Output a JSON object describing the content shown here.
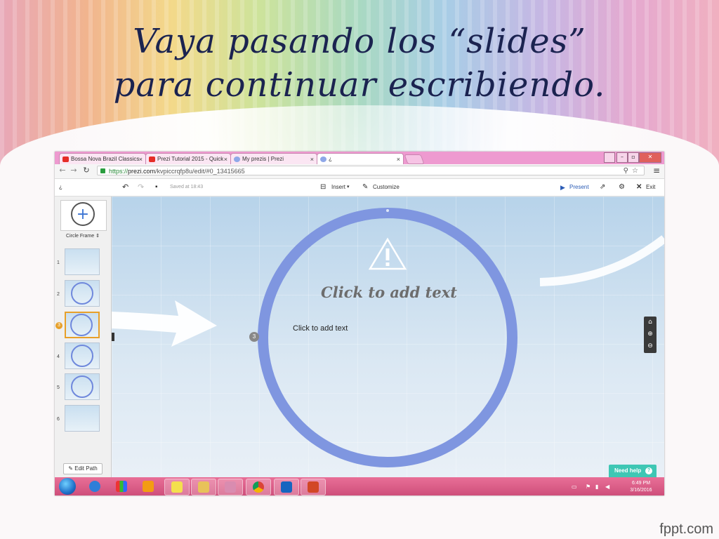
{
  "slide": {
    "title_line1": "Vaya pasando los “slides”",
    "title_line2": "para continuar escribiendo.",
    "watermark": "fppt.com"
  },
  "browser": {
    "tabs": [
      {
        "label": "Bossa Nova Brazil Classics",
        "icon": "youtube-icon",
        "color": "#e52d27"
      },
      {
        "label": "Prezi Tutorial 2015 - Quick",
        "icon": "youtube-icon",
        "color": "#e52d27"
      },
      {
        "label": "My prezis | Prezi",
        "icon": "prezi-icon",
        "color": "#3b74d3"
      },
      {
        "label": "¿",
        "icon": "prezi-icon",
        "color": "#3b74d3"
      }
    ],
    "tab_close": "×",
    "url_protocol": "https://",
    "url_host": "prezi.com",
    "url_path": "/kvpiccrqfp8u/edit/#0_13415665"
  },
  "prezi_toolbar": {
    "doc_title": "¿",
    "saved": "Saved at 18:43",
    "insert": "Insert",
    "customize": "Customize",
    "present": "Present",
    "exit": "Exit"
  },
  "sidebar": {
    "frame_type": "Circle Frame",
    "thumbnails": [
      "1",
      "2",
      "3",
      "4",
      "5",
      "6"
    ],
    "selected_index": 2,
    "edit_path": "Edit Path"
  },
  "canvas": {
    "title_placeholder": "Click to add text",
    "body_placeholder": "Click to add text",
    "path_number": "3"
  },
  "help": {
    "label": "Need help",
    "icon": "question-icon"
  },
  "taskbar": {
    "time": "6:49 PM",
    "date": "3/16/2016",
    "colors": {
      "accent": "#7f96e0",
      "taskbar": "#e86f97",
      "help": "#3ec7b4"
    }
  }
}
